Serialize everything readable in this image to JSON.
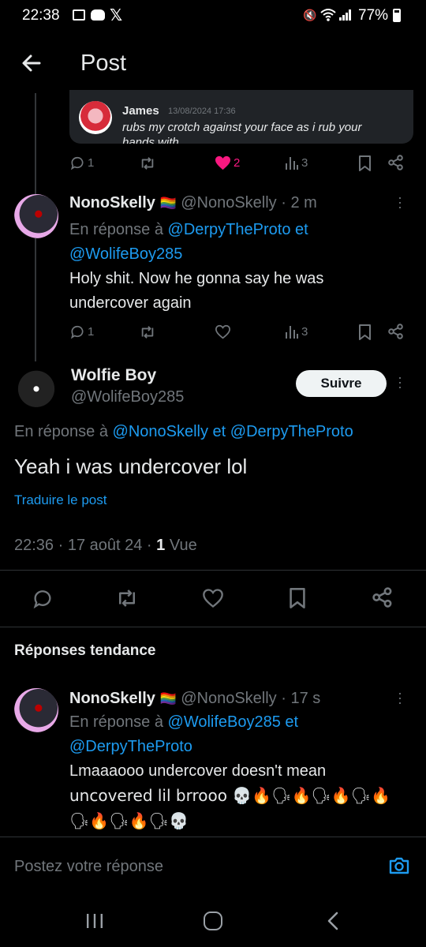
{
  "status_bar": {
    "time": "22:38",
    "battery": "77%"
  },
  "header": {
    "title": "Post"
  },
  "quoted": {
    "name": "James",
    "date": "13/08/2024 17:36",
    "text": "rubs my crotch against your face as i rub your",
    "text_cut": "hands with ..."
  },
  "row1_actions": {
    "replies": "1",
    "likes": "2",
    "views": "3"
  },
  "reply1": {
    "name": "NonoSkelly",
    "handle": "@NonoSkelly",
    "time": "· 2 m",
    "reply_prefix": "En réponse à ",
    "reply_to_1": "@DerpyTheProto",
    "reply_to_sep": " et",
    "reply_to_2": "@WolifeBoy285",
    "line1": "Holy shit. Now he gonna say he was",
    "line2": "undercover again",
    "replies": "1",
    "views": "3"
  },
  "main": {
    "name": "Wolfie Boy",
    "handle": "@WolifeBoy285",
    "follow_label": "Suivre",
    "reply_prefix": "En réponse à ",
    "reply_to_1": "@NonoSkelly",
    "reply_to_sep": " et ",
    "reply_to_2": "@DerpyTheProto",
    "text": "Yeah i was undercover lol",
    "translate": "Traduire le post",
    "time": "22:36",
    "date": "· 17 août 24 ·",
    "views_count": "1",
    "views_label": "Vue"
  },
  "trending": {
    "title": "Réponses tendance"
  },
  "reply2": {
    "name": "NonoSkelly",
    "handle": "@NonoSkelly",
    "time": "· 17 s",
    "reply_prefix": "En réponse à ",
    "reply_to_1": "@WolifeBoy285",
    "reply_to_sep": " et",
    "reply_to_2": "@DerpyTheProto",
    "line1": "Lmaaaooo undercover doesn't mean",
    "line2": "uncovered lil brrooo 💀🔥🗣🔥🗣🔥🗣🔥",
    "line3": "🗣🔥🗣🔥🗣💀"
  },
  "composer": {
    "placeholder": "Postez votre réponse"
  },
  "colors": {
    "accent": "#1d9bf0",
    "like": "#f91880",
    "background": "#000000"
  }
}
